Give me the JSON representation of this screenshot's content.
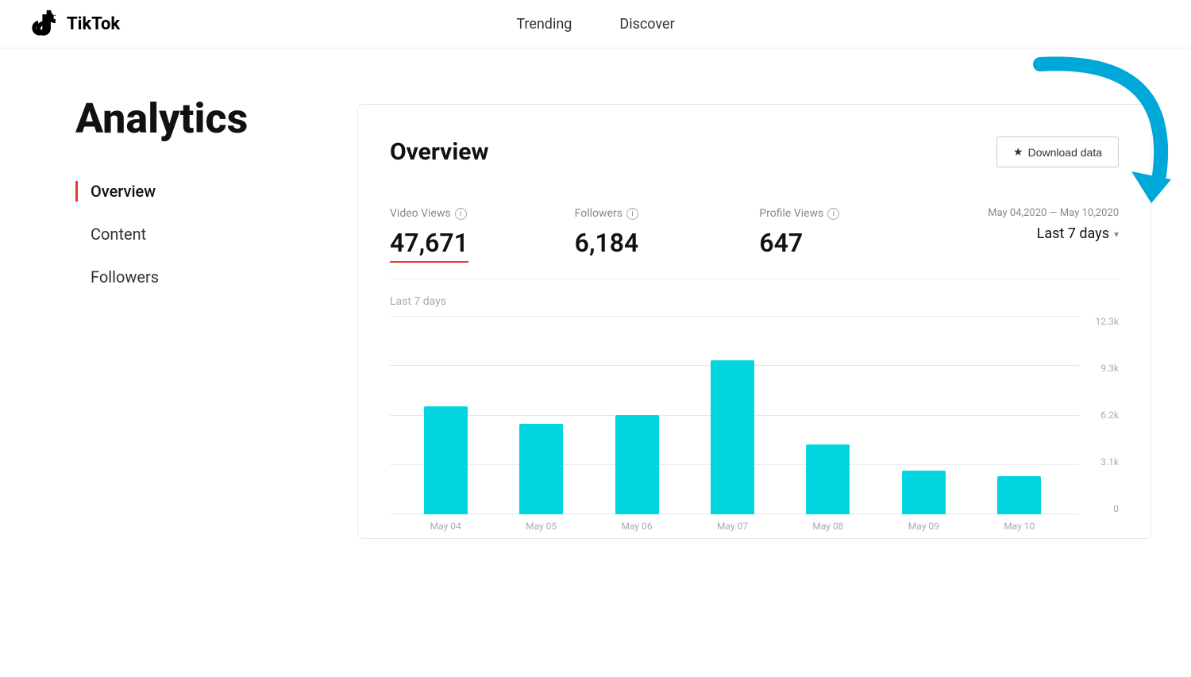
{
  "header": {
    "logo_text": "TikTok",
    "nav": {
      "trending": "Trending",
      "discover": "Discover"
    }
  },
  "sidebar": {
    "page_title": "Analytics",
    "nav_items": [
      {
        "id": "overview",
        "label": "Overview",
        "active": true
      },
      {
        "id": "content",
        "label": "Content",
        "active": false
      },
      {
        "id": "followers",
        "label": "Followers",
        "active": false
      }
    ]
  },
  "overview": {
    "title": "Overview",
    "download_btn": "Download data",
    "stats": {
      "video_views": {
        "label": "Video Views",
        "value": "47,671"
      },
      "followers": {
        "label": "Followers",
        "value": "6,184"
      },
      "profile_views": {
        "label": "Profile Views",
        "value": "647"
      }
    },
    "date_range": {
      "text": "May 04,2020 — May 10,2020",
      "period_select": "Last 7 days"
    },
    "chart": {
      "period_label": "Last 7 days",
      "y_labels": [
        "12.3k",
        "9.3k",
        "6.2k",
        "3.1k",
        "0"
      ],
      "bars": [
        {
          "date": "May 04",
          "height_pct": 62
        },
        {
          "date": "May 05",
          "height_pct": 52
        },
        {
          "date": "May 06",
          "height_pct": 57
        },
        {
          "date": "May 07",
          "height_pct": 88
        },
        {
          "date": "May 08",
          "height_pct": 40
        },
        {
          "date": "May 09",
          "height_pct": 25
        },
        {
          "date": "May 10",
          "height_pct": 22
        }
      ]
    }
  },
  "colors": {
    "accent_red": "#e8392b",
    "tiktok_cyan": "#00d5e0",
    "arrow_cyan": "#00a8d9"
  }
}
